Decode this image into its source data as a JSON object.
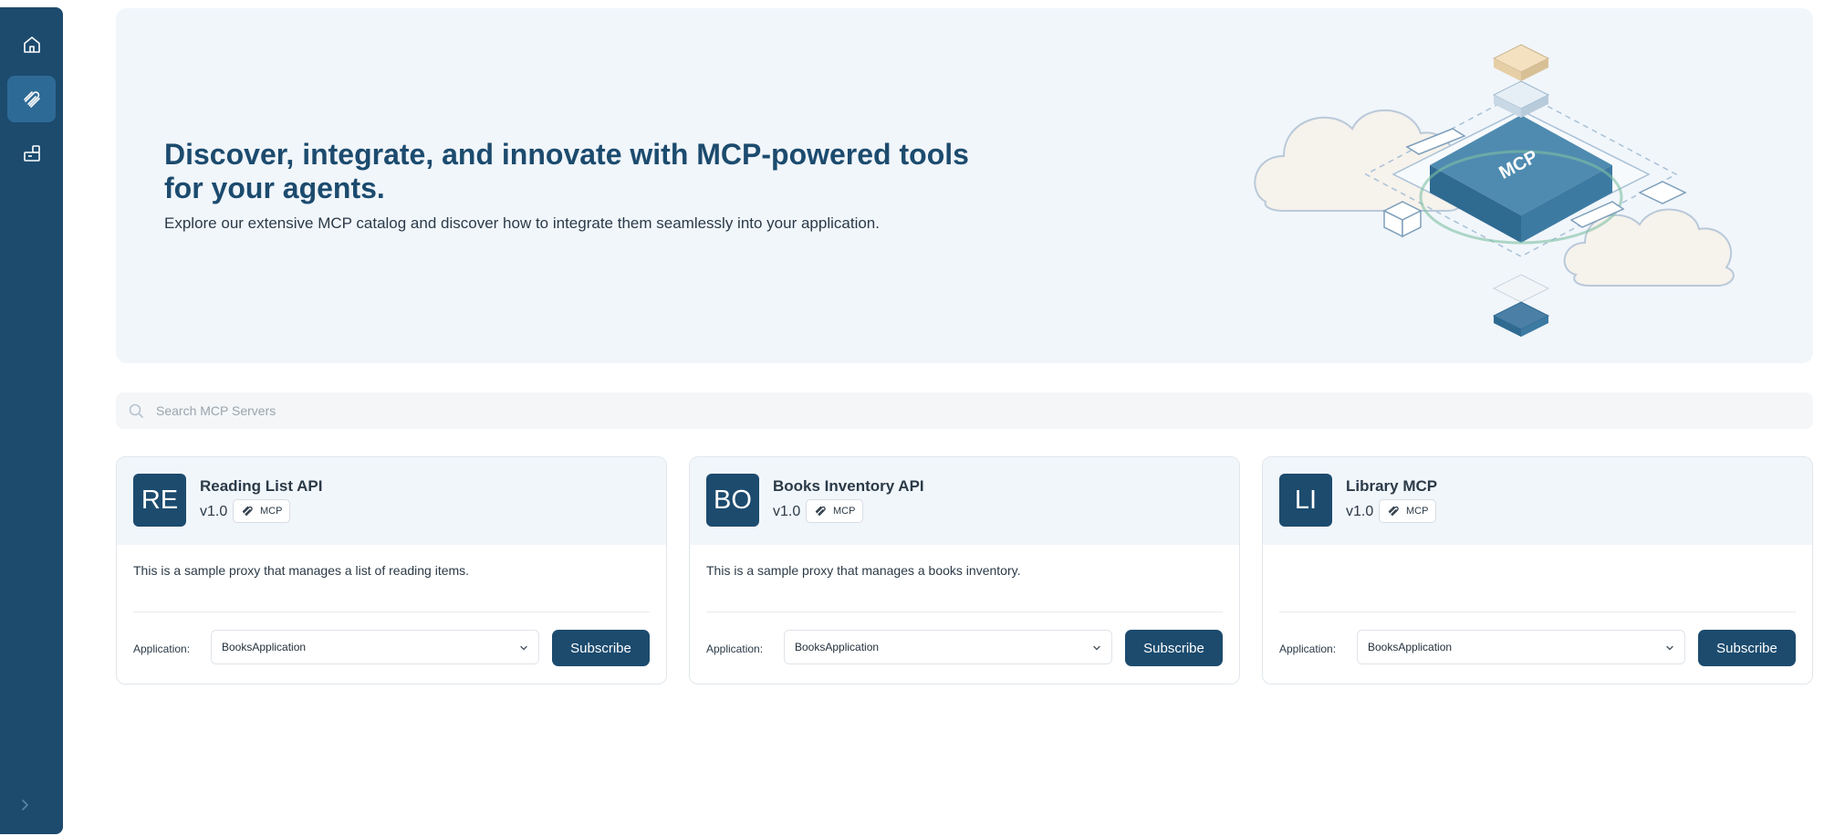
{
  "sidebar": {
    "items": [
      {
        "icon": "home-icon",
        "active": false
      },
      {
        "icon": "mcp-icon",
        "active": true
      },
      {
        "icon": "applications-icon",
        "active": false
      }
    ],
    "expand_icon": "chevron-right-icon"
  },
  "hero": {
    "title": "Discover, integrate, and innovate with MCP-powered tools for your agents.",
    "subtitle": "Explore our extensive MCP catalog and discover how to integrate them seamlessly into your application.",
    "illustration_label": "MCP"
  },
  "search": {
    "placeholder": "Search MCP Servers",
    "value": ""
  },
  "cards": [
    {
      "initials": "RE",
      "title": "Reading List API",
      "version": "v1.0",
      "tag": "MCP",
      "description": "This is a sample proxy that manages a list of reading items.",
      "app_label": "Application:",
      "app_value": "BooksApplication",
      "subscribe_label": "Subscribe"
    },
    {
      "initials": "BO",
      "title": "Books Inventory API",
      "version": "v1.0",
      "tag": "MCP",
      "description": "This is a sample proxy that manages a books inventory.",
      "app_label": "Application:",
      "app_value": "BooksApplication",
      "subscribe_label": "Subscribe"
    },
    {
      "initials": "LI",
      "title": "Library MCP",
      "version": "v1.0",
      "tag": "MCP",
      "description": "",
      "app_label": "Application:",
      "app_value": "BooksApplication",
      "subscribe_label": "Subscribe"
    }
  ],
  "colors": {
    "primary": "#1c4b6e",
    "sidebar_active": "#2e6a96",
    "hero_background": "#f1f6fb",
    "search_background": "#f4f6f8"
  }
}
